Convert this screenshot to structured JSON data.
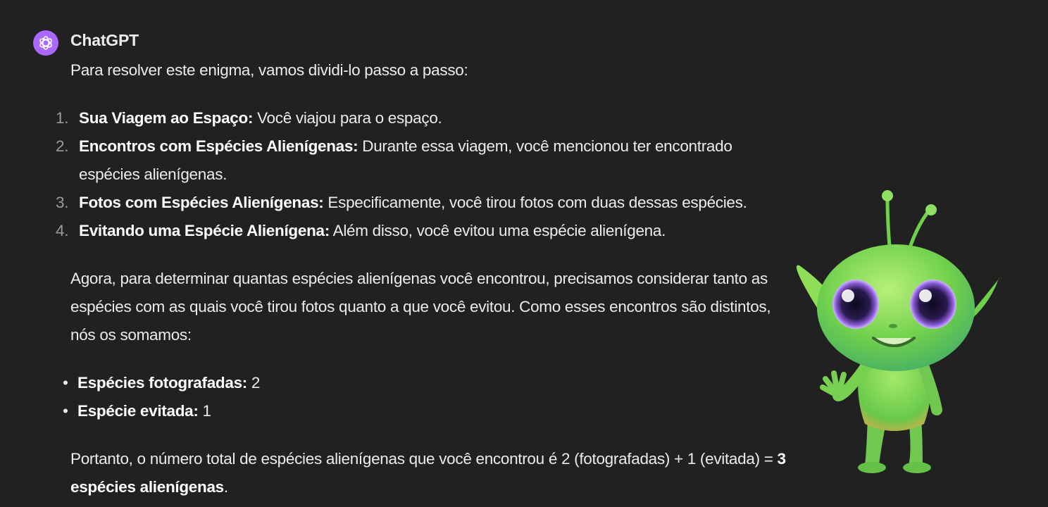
{
  "message": {
    "author": "ChatGPT",
    "avatar_icon": "openai-logo-icon",
    "avatar_color": "#ab68ff",
    "intro": "Para resolver este enigma, vamos dividi-lo passo a passo:",
    "steps": [
      {
        "num": "1.",
        "bold": "Sua Viagem ao Espaço:",
        "text": " Você viajou para o espaço."
      },
      {
        "num": "2.",
        "bold": "Encontros com Espécies Alienígenas:",
        "text": " Durante essa viagem, você mencionou ter encontrado espécies alienígenas."
      },
      {
        "num": "3.",
        "bold": "Fotos com Espécies Alienígenas:",
        "text": " Especificamente, você tirou fotos com duas dessas espécies."
      },
      {
        "num": "4.",
        "bold": "Evitando uma Espécie Alienígena:",
        "text": " Além disso, você evitou uma espécie alienígena."
      }
    ],
    "paragraph": "Agora, para determinar quantas espécies alienígenas você encontrou, precisamos considerar tanto as espécies com as quais você tirou fotos quanto a que você evitou. Como esses encontros são distintos, nós os somamos:",
    "bullets": [
      {
        "bold": "Espécies fotografadas:",
        "text": " 2"
      },
      {
        "bold": "Espécie evitada:",
        "text": " 1"
      }
    ],
    "conclusion_prefix": "Portanto, o número total de espécies alienígenas que você encontrou é 2 (fotografadas) + 1 (evitada) = ",
    "conclusion_bold": "3 espécies alienígenas",
    "conclusion_suffix": "."
  },
  "colors": {
    "background": "#212121",
    "text": "#ececec",
    "list_number": "#9b9b9b",
    "alien_skin": "#7ed957"
  },
  "illustration": {
    "icon": "green-alien-waving-icon"
  }
}
